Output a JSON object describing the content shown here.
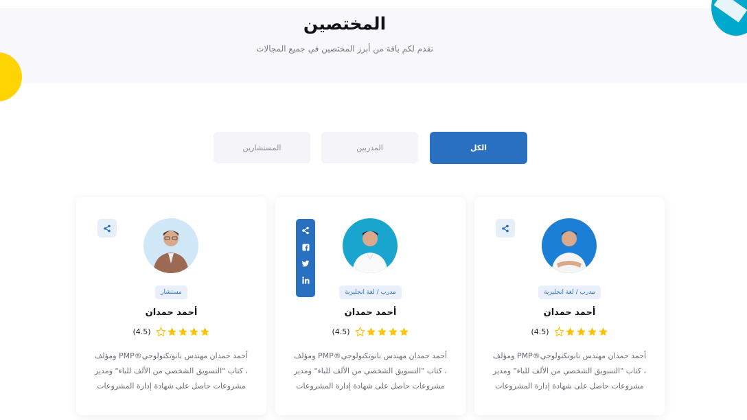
{
  "hero": {
    "title": "المختصين",
    "subtitle": "نقدم لكم باقة من أبرز المختصين في جميع المجالات"
  },
  "tabs": [
    {
      "label": "الكل",
      "active": true
    },
    {
      "label": "المدربين",
      "active": false
    },
    {
      "label": "المستشارين",
      "active": false
    }
  ],
  "cards": [
    {
      "role": "مدرب / لغة انجليزية",
      "name": "أحمد حمدان",
      "rating_text": "(4.5)",
      "rating": 4.5,
      "description": "أحمد حمدان مهندس نانوتكنولوجي®PMP ومؤلف ، كتاب \"التسويق الشخصي من الألف للباء\" ومدير مشروعات حاصل على شهادة إدارة المشروعات",
      "share_open": false,
      "avatar_bg": "#1c7fd6"
    },
    {
      "role": "مدرب / لغة انجليزية",
      "name": "أحمد حمدان",
      "rating_text": "(4.5)",
      "rating": 4.5,
      "description": "أحمد حمدان مهندس نانوتكنولوجي®PMP ومؤلف ، كتاب \"التسويق الشخصي من الألف للباء\" ومدير مشروعات حاصل على شهادة إدارة المشروعات",
      "share_open": true,
      "share_icons": [
        "share-icon",
        "facebook-icon",
        "twitter-icon",
        "linkedin-icon"
      ],
      "avatar_bg": "#1aa5cf"
    },
    {
      "role": "مستشار",
      "name": "أحمد حمدان",
      "rating_text": "(4.5)",
      "rating": 4.5,
      "description": "أحمد حمدان مهندس نانوتكنولوجي®PMP ومؤلف ، كتاب \"التسويق الشخصي من الألف للباء\" ومدير مشروعات حاصل على شهادة إدارة المشروعات",
      "share_open": false,
      "avatar_bg": "#cfe7f6"
    }
  ],
  "colors": {
    "primary": "#2970c1",
    "star": "#ffc107",
    "hero_bg": "#f7f7fc",
    "accent_teal": "#00a8cc",
    "accent_yellow": "#ffd400"
  }
}
